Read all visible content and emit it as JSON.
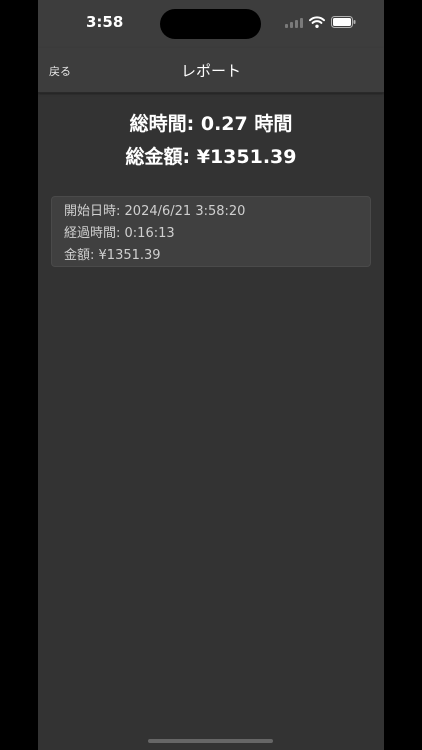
{
  "status_bar": {
    "time": "3:58"
  },
  "nav": {
    "back_label": "戻る",
    "title": "レポート"
  },
  "summary": {
    "total_time_label": "総時間:",
    "total_time_value": "0.27 時間",
    "total_amount_label": "総金額:",
    "total_amount_value": "¥1351.39"
  },
  "records": [
    {
      "start_label": "開始日時:",
      "start_value": "2024/6/21 3:58:20",
      "elapsed_label": "経過時間:",
      "elapsed_value": "0:16:13",
      "amount_label": "金額:",
      "amount_value": "¥1351.39"
    }
  ],
  "icons": {
    "signal": "cellular-signal-icon",
    "wifi": "wifi-icon",
    "battery": "battery-icon"
  },
  "colors": {
    "background": "#333333",
    "bar_background": "#3d3d3d",
    "card_background": "#404040",
    "text_primary": "#ffffff",
    "text_secondary": "#cfcfcf"
  }
}
